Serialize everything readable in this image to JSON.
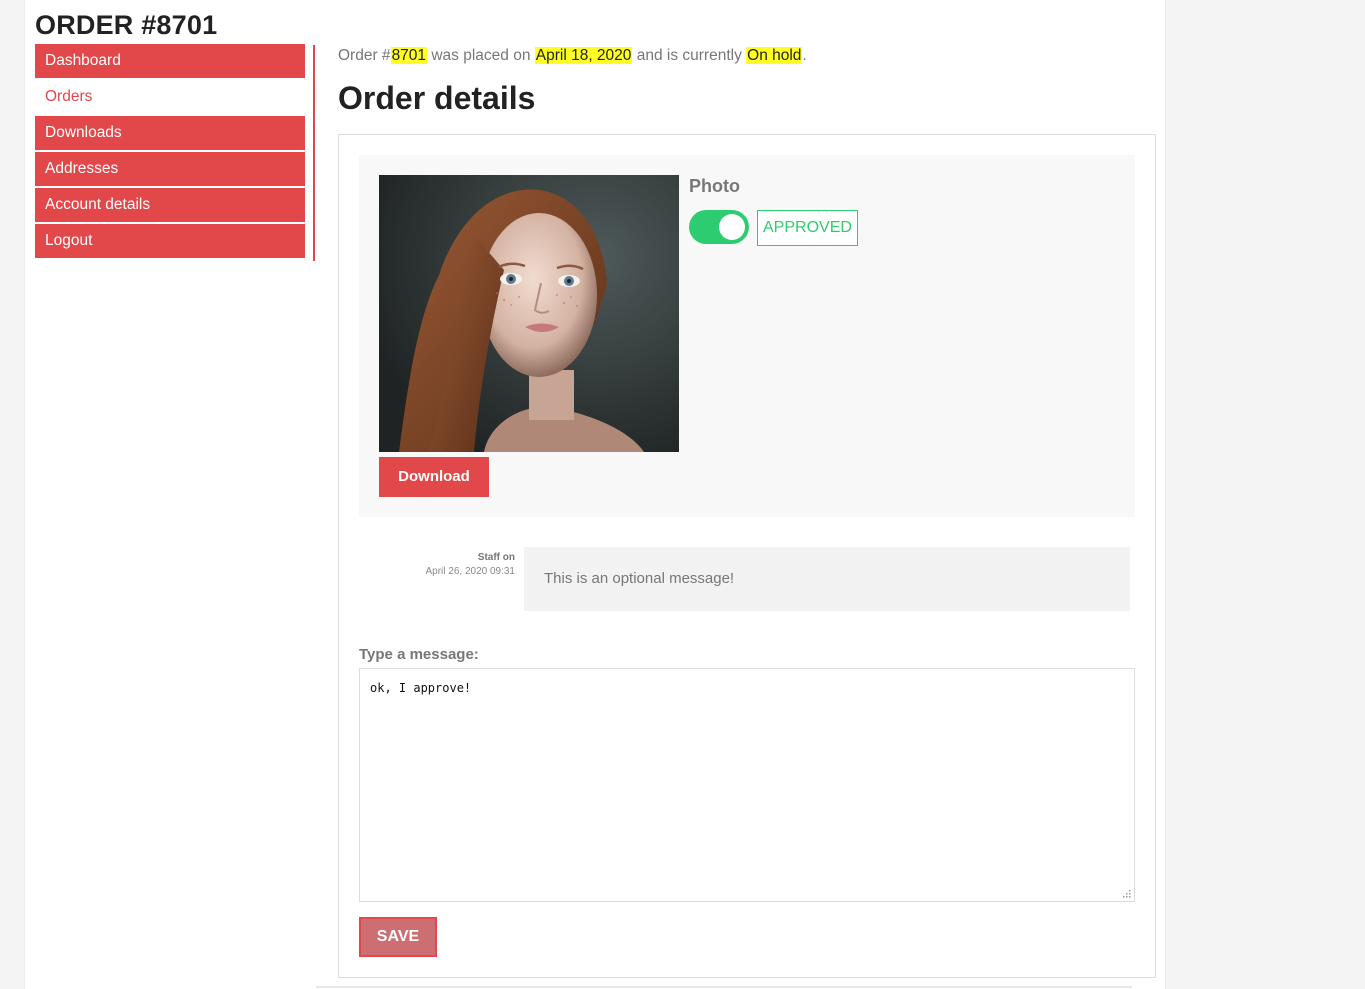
{
  "page": {
    "title": "ORDER #8701"
  },
  "sidebar": {
    "items": [
      {
        "label": "Dashboard",
        "active": false
      },
      {
        "label": "Orders",
        "active": true
      },
      {
        "label": "Downloads",
        "active": false
      },
      {
        "label": "Addresses",
        "active": false
      },
      {
        "label": "Account details",
        "active": false
      },
      {
        "label": "Logout",
        "active": false
      }
    ]
  },
  "summary": {
    "prefix": "Order #",
    "order_number": "8701",
    "placed_text": " was placed on ",
    "date": "April 18, 2020",
    "status_text": " and is currently ",
    "status": "On hold",
    "suffix": "."
  },
  "details": {
    "heading": "Order details",
    "item": {
      "label": "Photo",
      "approved": true,
      "status_badge": "APPROVED",
      "download_label": "Download"
    },
    "message": {
      "author": "Staff on",
      "timestamp": "April 26, 2020 09:31",
      "text": "This is an optional message!"
    },
    "reply": {
      "label": "Type a message:",
      "value": "ok, I approve!",
      "save_label": "SAVE"
    }
  },
  "colors": {
    "accent": "#e2474a",
    "success": "#2ecc71",
    "highlight": "#ffff26",
    "save_button": "#cd6e72"
  }
}
